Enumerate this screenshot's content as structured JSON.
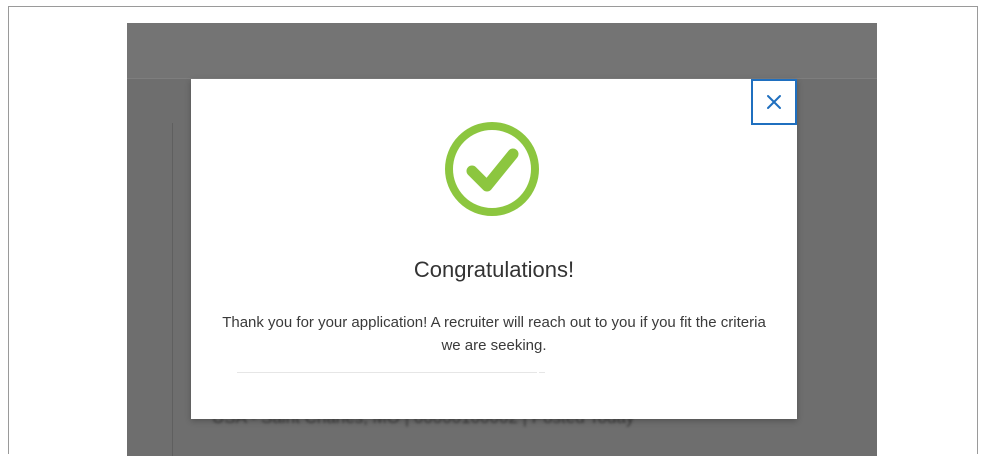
{
  "background": {
    "link_fragment": "m",
    "meta_line": "USA - Saint Charles, MO  |  00000100002  |  Posted Today"
  },
  "modal": {
    "close_symbol": "×",
    "title": "Congratulations!",
    "message": "Thank you for your application! A recruiter will reach out to you if you fit the criteria we are seeking."
  },
  "icons": {
    "success": "check-circle-icon",
    "close": "close-icon"
  },
  "colors": {
    "success_green": "#8cc63f",
    "focus_blue": "#1f6fbf",
    "overlay_gray": "#6e6e6e"
  }
}
